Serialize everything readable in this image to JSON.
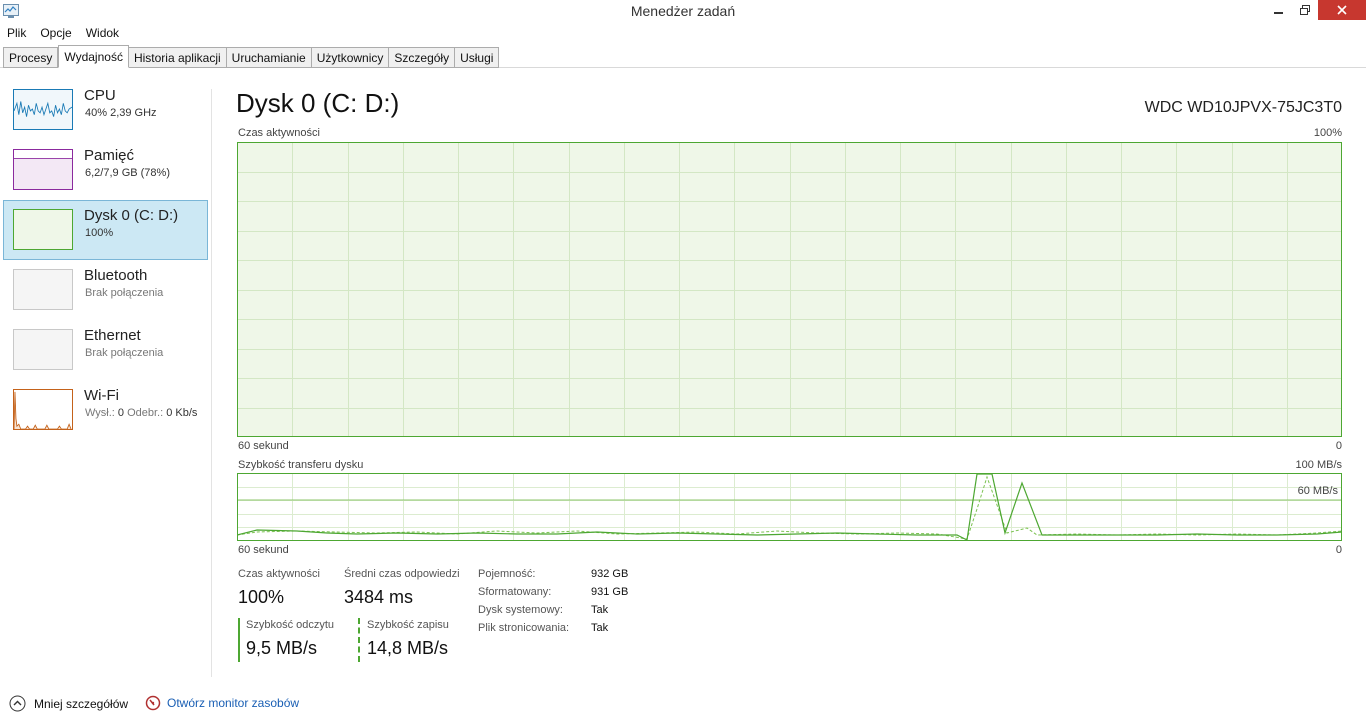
{
  "window": {
    "title": "Menedżer zadań"
  },
  "menu": [
    "Plik",
    "Opcje",
    "Widok"
  ],
  "tabs": [
    {
      "label": "Procesy",
      "active": false
    },
    {
      "label": "Wydajność",
      "active": true
    },
    {
      "label": "Historia aplikacji",
      "active": false
    },
    {
      "label": "Uruchamianie",
      "active": false
    },
    {
      "label": "Użytkownicy",
      "active": false
    },
    {
      "label": "Szczegóły",
      "active": false
    },
    {
      "label": "Usługi",
      "active": false
    }
  ],
  "sidebar": {
    "items": [
      {
        "title": "CPU",
        "subtitle": "40% 2,39 GHz",
        "icon": "cpu-graph-icon",
        "color": "#1a7ab5",
        "selected": false
      },
      {
        "title": "Pamięć",
        "subtitle": "6,2/7,9 GB (78%)",
        "icon": "memory-graph-icon",
        "color": "#8b2a9e",
        "selected": false
      },
      {
        "title": "Dysk 0 (C: D:)",
        "subtitle": "100%",
        "icon": "disk-graph-icon",
        "color": "#4da732",
        "selected": true
      },
      {
        "title": "Bluetooth",
        "subtitle": "Brak połączenia",
        "icon": "bluetooth-graph-icon",
        "color": "#b9b9b9",
        "selected": false
      },
      {
        "title": "Ethernet",
        "subtitle": "Brak połączenia",
        "icon": "ethernet-graph-icon",
        "color": "#b9b9b9",
        "selected": false
      },
      {
        "title": "Wi-Fi",
        "subtitle_parts": [
          "Wysł.: ",
          "0",
          " Odebr.: ",
          "0 Kb/s"
        ],
        "icon": "wifi-graph-icon",
        "color": "#c4621a",
        "selected": false
      }
    ]
  },
  "main": {
    "title": "Dysk 0 (C: D:)",
    "model": "WDC WD10JPVX-75JC3T0",
    "graph1": {
      "label": "Czas aktywności",
      "max": "100%",
      "time": "60 sekund",
      "zero": "0",
      "value_percent": 100
    },
    "graph2": {
      "label": "Szybkość transferu dysku",
      "max": "100 MB/s",
      "mid": "60 MB/s",
      "time": "60 sekund",
      "zero": "0"
    }
  },
  "stats": {
    "active_label": "Czas aktywności",
    "active_value": "100%",
    "response_label": "Średni czas odpowiedzi",
    "response_value": "3484 ms",
    "read_label": "Szybkość odczytu",
    "read_value": "9,5 MB/s",
    "write_label": "Szybkość zapisu",
    "write_value": "14,8 MB/s"
  },
  "properties": [
    {
      "label": "Pojemność:",
      "value": "932 GB"
    },
    {
      "label": "Sformatowany:",
      "value": "931 GB"
    },
    {
      "label": "Dysk systemowy:",
      "value": "Tak"
    },
    {
      "label": "Plik stronicowania:",
      "value": "Tak"
    }
  ],
  "footer": {
    "less_details": "Mniej szczegółów",
    "resource_monitor": "Otwórz monitor zasobów"
  },
  "colors": {
    "accent_green": "#4da732",
    "graph_fill": "#eff7e8",
    "selection": "#cce8f4",
    "close_red": "#c7372f",
    "link": "#1a5fb4"
  }
}
